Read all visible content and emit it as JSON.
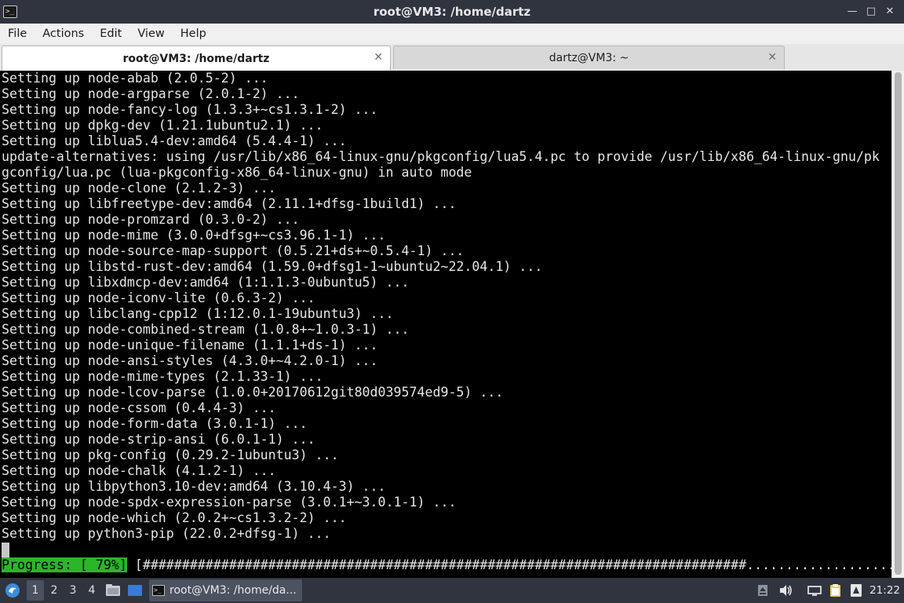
{
  "window": {
    "title": "root@VM3: /home/dartz",
    "app_icon": "terminal-icon",
    "app_icon_glyph": ">_",
    "minimize_glyph": "—",
    "maximize_glyph": "□",
    "close_glyph": "✕"
  },
  "menu": [
    "File",
    "Actions",
    "Edit",
    "View",
    "Help"
  ],
  "tabs": [
    {
      "label": "root@VM3: /home/dartz",
      "active": true
    },
    {
      "label": "dartz@VM3: ~",
      "active": false
    }
  ],
  "tab_close_glyph": "✕",
  "terminal": {
    "lines": [
      "Setting up node-abab (2.0.5-2) ...",
      "Setting up node-argparse (2.0.1-2) ...",
      "Setting up node-fancy-log (1.3.3+~cs1.3.1-2) ...",
      "Setting up dpkg-dev (1.21.1ubuntu2.1) ...",
      "Setting up liblua5.4-dev:amd64 (5.4.4-1) ...",
      "update-alternatives: using /usr/lib/x86_64-linux-gnu/pkgconfig/lua5.4.pc to provide /usr/lib/x86_64-linux-gnu/pk",
      "gconfig/lua.pc (lua-pkgconfig-x86_64-linux-gnu) in auto mode",
      "Setting up node-clone (2.1.2-3) ...",
      "Setting up libfreetype-dev:amd64 (2.11.1+dfsg-1build1) ...",
      "Setting up node-promzard (0.3.0-2) ...",
      "Setting up node-mime (3.0.0+dfsg+~cs3.96.1-1) ...",
      "Setting up node-source-map-support (0.5.21+ds+~0.5.4-1) ...",
      "Setting up libstd-rust-dev:amd64 (1.59.0+dfsg1-1~ubuntu2~22.04.1) ...",
      "Setting up libxdmcp-dev:amd64 (1:1.1.3-0ubuntu5) ...",
      "Setting up node-iconv-lite (0.6.3-2) ...",
      "Setting up libclang-cpp12 (1:12.0.1-19ubuntu3) ...",
      "Setting up node-combined-stream (1.0.8+~1.0.3-1) ...",
      "Setting up node-unique-filename (1.1.1+ds-1) ...",
      "Setting up node-ansi-styles (4.3.0+~4.2.0-1) ...",
      "Setting up node-mime-types (2.1.33-1) ...",
      "Setting up node-lcov-parse (1.0.0+20170612git80d039574ed9-5) ...",
      "Setting up node-cssom (0.4.4-3) ...",
      "Setting up node-form-data (3.0.1-1) ...",
      "Setting up node-strip-ansi (6.0.1-1) ...",
      "Setting up pkg-config (0.29.2-1ubuntu3) ...",
      "Setting up node-chalk (4.1.2-1) ...",
      "Setting up libpython3.10-dev:amd64 (3.10.4-3) ...",
      "Setting up node-spdx-expression-parse (3.0.1+~3.0.1-1) ...",
      "Setting up node-which (2.0.2+~cs1.3.2-2) ...",
      "Setting up python3-pip (22.0.2+dfsg-1) ..."
    ],
    "progress_label": "Progress: [ 79%]",
    "progress_bar": " [#############################################################################...................] ",
    "progress_fraction": 0.79
  },
  "taskbar": {
    "start_icon": "start-menu-icon",
    "desktops": [
      "1",
      "2",
      "3",
      "4"
    ],
    "active_desktop": "1",
    "window_button_label": "root@VM3: /home/da...",
    "clock": "21:22"
  }
}
